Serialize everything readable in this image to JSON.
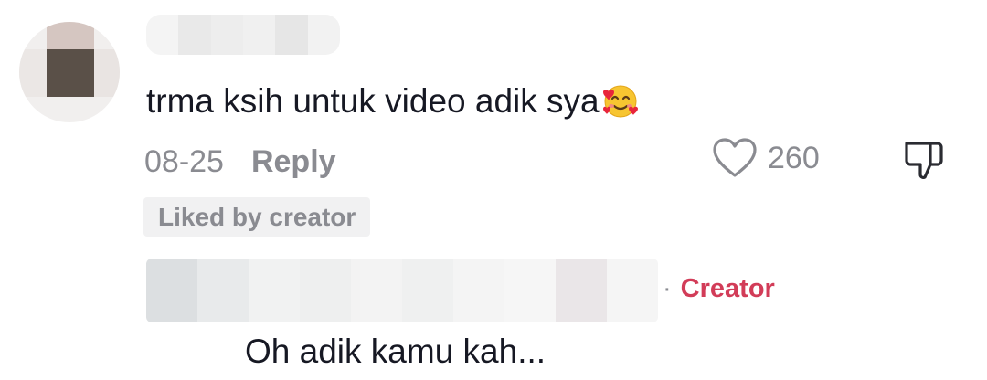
{
  "comment": {
    "username": "",
    "text": "trma ksih untuk video adik sya",
    "emoji": "smiling-face-with-hearts",
    "date": "08-25",
    "reply_label": "Reply",
    "like_count": "260",
    "liked_by_creator_label": "Liked by creator"
  },
  "reply": {
    "username": "",
    "creator_label": "Creator",
    "separator": "·",
    "text": "Oh adik kamu kah..."
  },
  "colors": {
    "text_primary": "#161823",
    "text_secondary": "#8a8b91",
    "creator_accent": "#d23c58",
    "badge_bg": "#f1f1f2"
  },
  "icons": {
    "like": "heart-outline-icon",
    "dislike": "thumbs-down-icon"
  }
}
